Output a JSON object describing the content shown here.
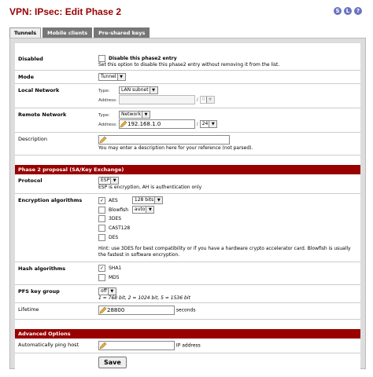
{
  "page": {
    "title": "VPN: IPsec: Edit Phase 2"
  },
  "top_icons": [
    "S",
    "L",
    "?"
  ],
  "tabs": [
    {
      "label": "Tunnels",
      "active": true
    },
    {
      "label": "Mobile clients",
      "active": false
    },
    {
      "label": "Pre-shared keys",
      "active": false
    }
  ],
  "disabled": {
    "label": "Disabled",
    "checkbox_label": "Disable this phase2 entry",
    "hint": "Set this option to disable this phase2 entry without removing it from the list.",
    "checked": false
  },
  "mode": {
    "label": "Mode",
    "value": "Tunnel"
  },
  "local_network": {
    "label": "Local Network",
    "type_label": "Type:",
    "type_value": "LAN subnet",
    "address_label": "Address:",
    "address_value": "",
    "slash": "/",
    "mask_value": "0"
  },
  "remote_network": {
    "label": "Remote Network",
    "type_label": "Type:",
    "type_value": "Network",
    "address_label": "Address:",
    "address_value": "192.168.1.0",
    "slash": "/",
    "mask_value": "24"
  },
  "description": {
    "label": "Description",
    "value": "",
    "hint": "You may enter a description here for your reference (not parsed)."
  },
  "phase2_section": {
    "title": "Phase 2 proposal (SA/Key Exchange)"
  },
  "protocol": {
    "label": "Protocol",
    "value": "ESP",
    "hint": "ESP is encryption, AH is authentication only"
  },
  "encryption": {
    "label": "Encryption algorithms",
    "items": [
      {
        "name": "AES",
        "checked": true,
        "select": "128 bits"
      },
      {
        "name": "Blowfish",
        "checked": false,
        "select": "auto"
      },
      {
        "name": "3DES",
        "checked": false
      },
      {
        "name": "CAST128",
        "checked": false
      },
      {
        "name": "DES",
        "checked": false
      }
    ],
    "hint": "Hint: use 3DES for best compatibility or if you have a hardware crypto accelerator card. Blowfish is usually the fastest in software encryption."
  },
  "hash": {
    "label": "Hash algorithms",
    "items": [
      {
        "name": "SHA1",
        "checked": true
      },
      {
        "name": "MD5",
        "checked": false
      }
    ]
  },
  "pfs": {
    "label": "PFS key group",
    "value": "off",
    "hint": "1 = 768 bit, 2 = 1024 bit, 5 = 1536 bit"
  },
  "lifetime": {
    "label": "Lifetime",
    "value": "28800",
    "unit": "seconds"
  },
  "advanced_section": {
    "title": "Advanced Options"
  },
  "ping_host": {
    "label": "Automatically ping host",
    "value": "",
    "unit": "IP address"
  },
  "save_button": {
    "label": "Save"
  },
  "colors": {
    "accent": "#990000",
    "panel": "#dddddd",
    "icon": "#6b72c0"
  }
}
